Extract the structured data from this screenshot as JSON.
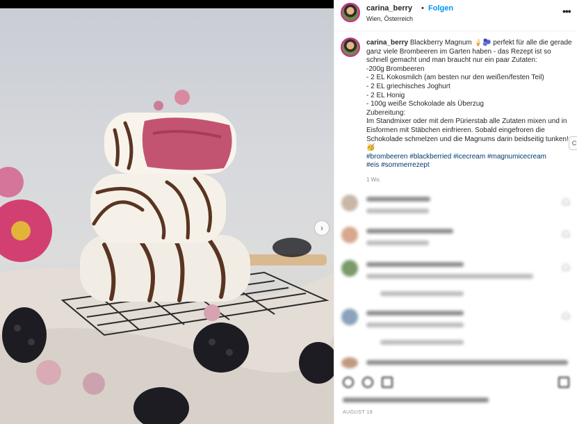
{
  "post": {
    "username": "carina_berry",
    "separator": "•",
    "follow_label": "Folgen",
    "location": "Wien, Österreich",
    "more_icon": "more-horizontal-icon",
    "caption": {
      "username": "carina_berry",
      "lines": [
        "Blackberry Magnum 🍦🫐 perfekt für alle die gerade ganz viele Brombeeren im Garten haben - das Rezept ist so schnell gemacht und man braucht nur ein paar Zutaten:",
        "-200g Brombeeren",
        "- 2 EL Kokosmilch (am besten nur den weißen/festen Teil)",
        "- 2 EL griechisches Joghurt",
        "- 2 EL Honig",
        "- 100g weiße Schokolade als Überzug",
        "Zubereitung:",
        "Im Standmixer oder mit dem Pürierstab alle Zutaten mixen und in Eisformen mit Stäbchen einfrieren. Sobald eingefroren die Schokolade schmelzen und die Magnums darin beidseitig tunken! 🥳"
      ],
      "hashtags_line1": "#brombeeren #blackberried #icecream #magnumicecream",
      "hashtags_line2": "#eis #sommerrezept",
      "time": "1 Wo."
    },
    "date": "AUGUST 18",
    "next_label": "›",
    "edge_label": "C"
  },
  "colors": {
    "follow": "#0095f6",
    "hashtag": "#00376b",
    "muted": "#8e8e8e",
    "active_dot": "#3b93f3"
  }
}
